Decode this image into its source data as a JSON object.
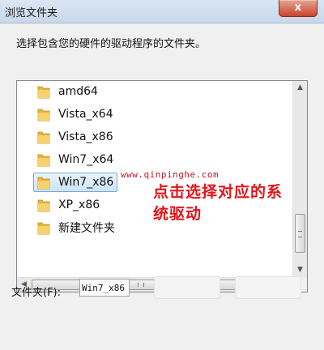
{
  "window": {
    "title": "浏览文件夹",
    "close_glyph": "x"
  },
  "dialog": {
    "instruction": "选择包含您的硬件的驱动程序的文件夹。",
    "folders": [
      {
        "label": "amd64",
        "selected": false
      },
      {
        "label": "Vista_x64",
        "selected": false
      },
      {
        "label": "Vista_x86",
        "selected": false
      },
      {
        "label": "Win7_x64",
        "selected": false
      },
      {
        "label": "Win7_x86",
        "selected": true
      },
      {
        "label": "XP_x86",
        "selected": false
      },
      {
        "label": "新建文件夹",
        "selected": false
      }
    ],
    "scroll": {
      "v_up": "▲",
      "v_down": "▼",
      "h_left": "◀",
      "h_right": "▶"
    },
    "folder_field": {
      "label": "文件夹(F):",
      "value": "Win7_x86"
    }
  },
  "overlay": {
    "watermark_url": "www.qinpinghe.com",
    "annotation": "点击选择对应的系统驱动"
  },
  "colors": {
    "folder": "#e8b53a",
    "selection": "#cce4f7",
    "annotation": "#e4141a"
  }
}
